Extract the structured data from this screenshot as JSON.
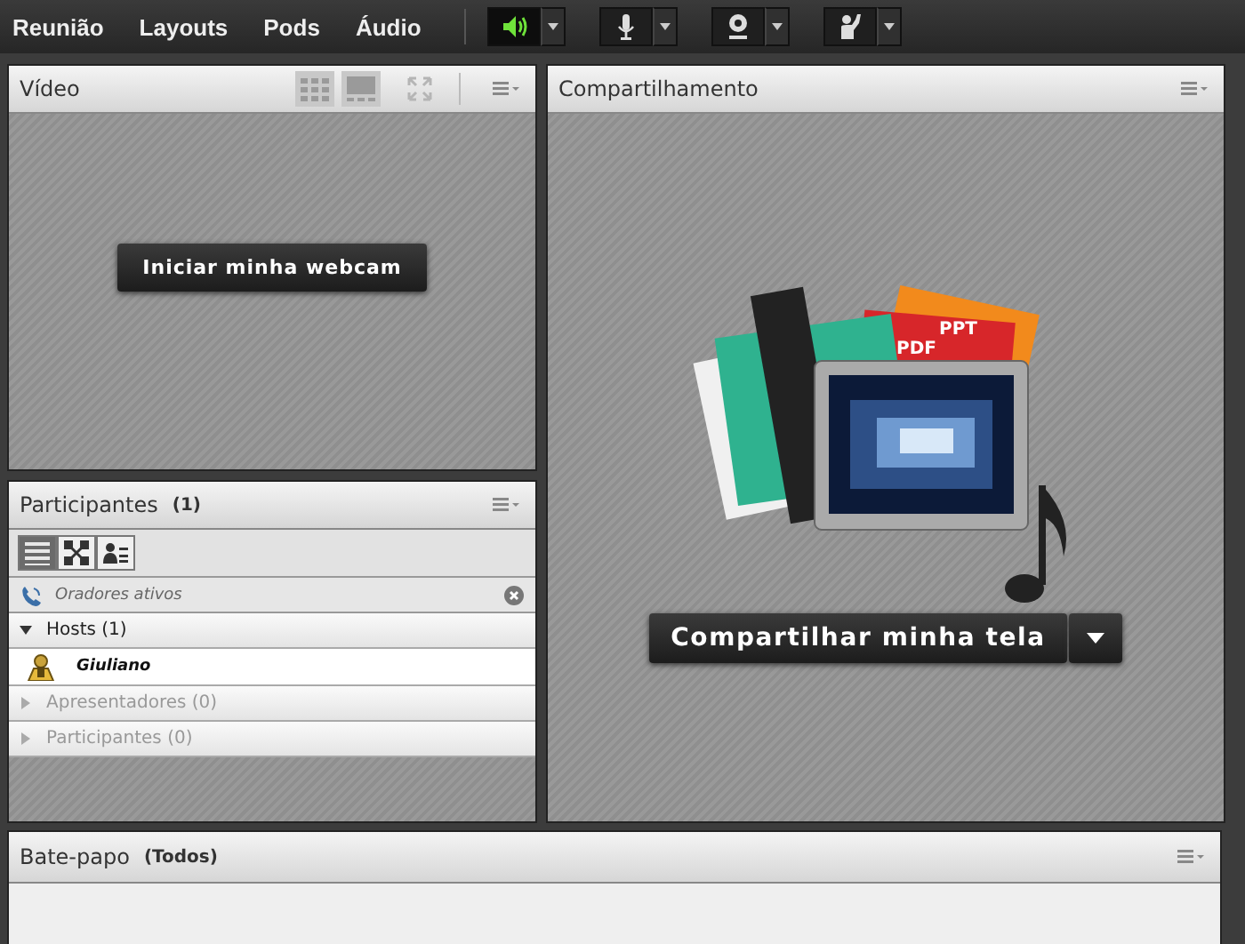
{
  "menu": [
    {
      "label": "Reunião"
    },
    {
      "label": "Layouts"
    },
    {
      "label": "Pods"
    },
    {
      "label": "Áudio"
    }
  ],
  "toolbar": [
    {
      "kind": "speaker",
      "on": true
    },
    {
      "kind": "mic",
      "on": false
    },
    {
      "kind": "webcam",
      "on": false
    },
    {
      "kind": "hand",
      "on": false
    }
  ],
  "video_pod": {
    "title": "Vídeo",
    "button": "Iniciar minha webcam"
  },
  "participants_pod": {
    "title": "Participantes",
    "count": "(1)",
    "views": [
      {
        "kind": "list",
        "selected": true
      },
      {
        "kind": "network",
        "selected": false
      },
      {
        "kind": "card",
        "selected": false
      }
    ],
    "filter": "Oradores ativos",
    "groups": [
      {
        "label": "Hosts (1)",
        "expanded": true,
        "children": [
          {
            "name": "Giuliano"
          }
        ]
      },
      {
        "label": "Apresentadores (0)",
        "expanded": false
      },
      {
        "label": "Participantes (0)",
        "expanded": false
      }
    ]
  },
  "share_pod": {
    "title": "Compartilhamento",
    "labels": [
      "PPT",
      "PDF"
    ],
    "button": "Compartilhar minha tela"
  },
  "chat_pod": {
    "title": "Bate-papo",
    "scope": "(Todos)"
  }
}
